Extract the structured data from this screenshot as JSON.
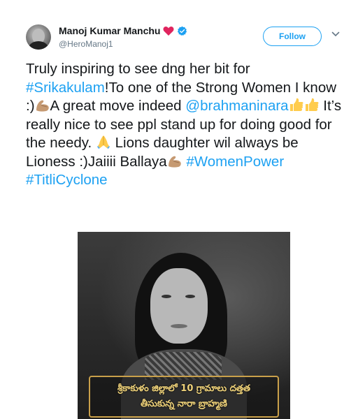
{
  "user": {
    "display_name": "Manoj Kumar Manchu",
    "handle": "@HeroManoj1",
    "verified": true,
    "heart_color": "#e0245e",
    "verified_color": "#1da1f2"
  },
  "actions": {
    "follow_label": "Follow"
  },
  "tweet": {
    "t1": "Truly inspiring to see dng her bit for ",
    "hashtag1": "#Srikakulam",
    "t2": "!To one of the Strong Women I know :)",
    "t3": "A great move indeed ",
    "mention": "@brahmaninara",
    "t4": " It’s really nice to see ppl stand up for doing good for the needy. ",
    "t5": " Lions daughter wil always be Lioness :)Jaiiii Ballaya",
    "t6": " ",
    "hashtag2": "#WomenPower",
    "t7": " ",
    "hashtag3": "#TitliCyclone",
    "emojis": [
      "flexed-biceps",
      "thumbs-up",
      "thumbs-up",
      "folded-hands",
      "flexed-biceps"
    ]
  },
  "media": {
    "caption_line1": "శ్రీకాకుళం జిల్లాలో 10 గ్రామాలు దత్తత",
    "caption_line2": "తీసుకున్న నారా బ్రాహ్మణి",
    "caption_color": "#f0d37a"
  }
}
